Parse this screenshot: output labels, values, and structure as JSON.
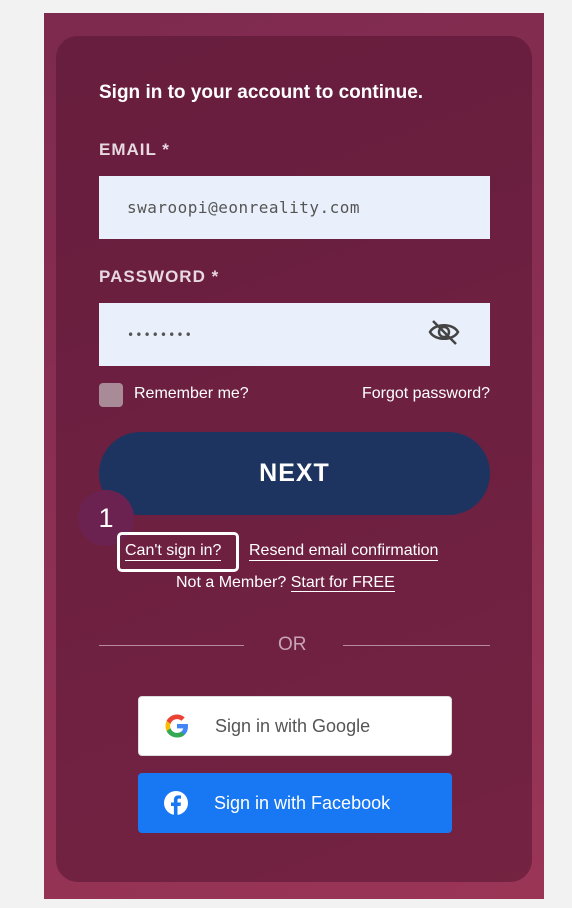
{
  "heading": "Sign in to your account to continue.",
  "email": {
    "label": "EMAIL *",
    "value": "swaroopi@eonreality.com"
  },
  "password": {
    "label": "PASSWORD *",
    "value": "••••••••"
  },
  "remember_label": "Remember me?",
  "forgot_label": "Forgot password?",
  "next_label": "NEXT",
  "step_marker": "1",
  "cant_sign_in": "Can't sign in?",
  "resend_label": "Resend email confirmation",
  "not_member_text": "Not a Member?",
  "start_free": "Start for FREE",
  "or_text": "OR",
  "google_label": "Sign in with Google",
  "facebook_label": "Sign in with Facebook",
  "colors": {
    "primary_button": "#1d3460",
    "facebook": "#1877f2",
    "background": "#8a2f53"
  },
  "icons": [
    "eye-off-icon",
    "google-icon",
    "facebook-icon"
  ]
}
